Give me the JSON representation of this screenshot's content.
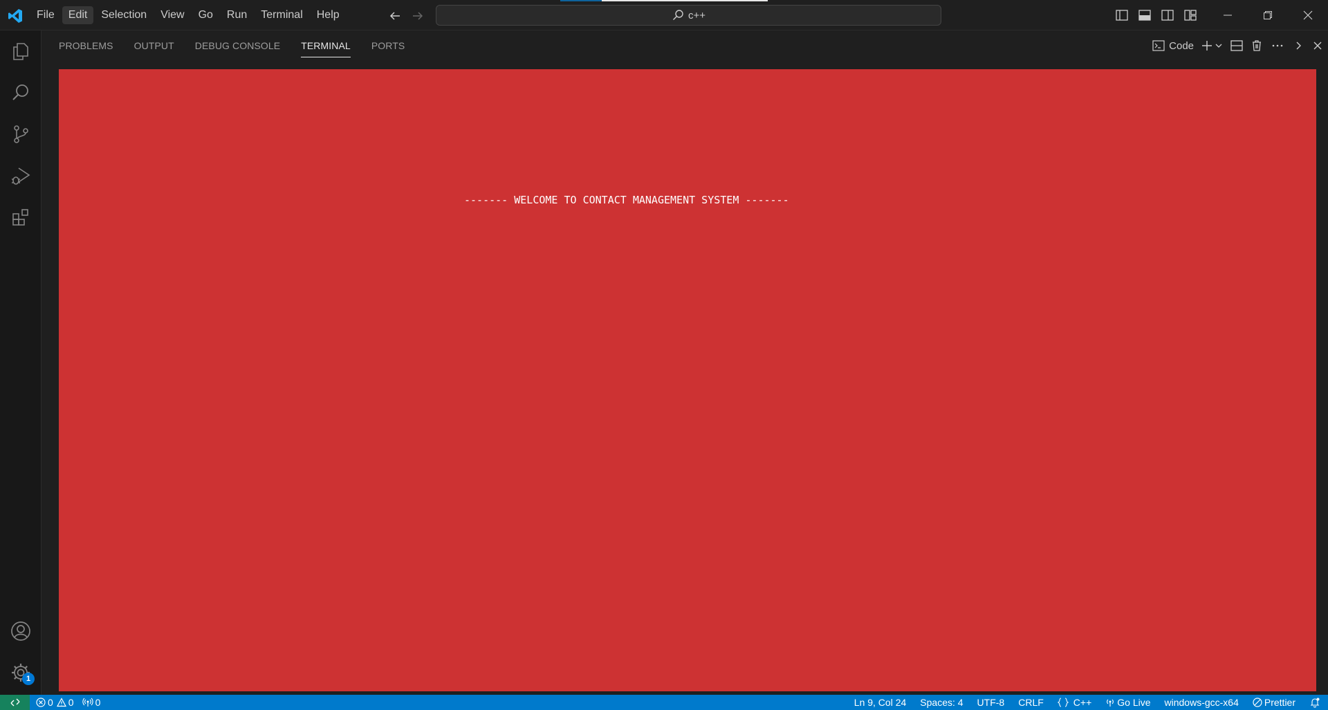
{
  "menu": [
    "File",
    "Edit",
    "Selection",
    "View",
    "Go",
    "Run",
    "Terminal",
    "Help"
  ],
  "search": {
    "text": "c++"
  },
  "panel": {
    "tabs": [
      "PROBLEMS",
      "OUTPUT",
      "DEBUG CONSOLE",
      "TERMINAL",
      "PORTS"
    ],
    "active_tab": "TERMINAL",
    "terminal_name": "Code"
  },
  "terminal": {
    "background_color": "#cd3233",
    "lines": [
      "------- WELCOME TO CONTACT MANAGEMENT SYSTEM -------"
    ]
  },
  "activity": {
    "settings_badge": "1"
  },
  "status": {
    "errors": "0",
    "warnings": "0",
    "ports": "0",
    "position": "Ln 9, Col 24",
    "spaces": "Spaces: 4",
    "encoding": "UTF-8",
    "eol": "CRLF",
    "language": "C++",
    "go_live": "Go Live",
    "config": "windows-gcc-x64",
    "prettier": "Prettier"
  },
  "colors": {
    "accent": "#007acc",
    "remote": "#16825d",
    "vscode_logo": "#23a9f2"
  }
}
